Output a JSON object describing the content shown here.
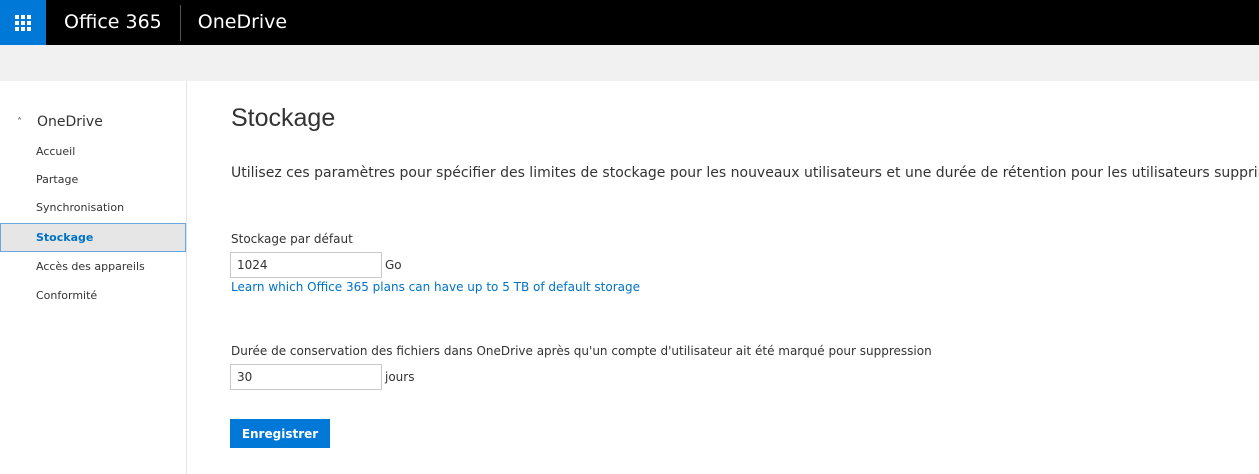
{
  "topbar": {
    "waffle_icon": "app-launcher-icon",
    "brand": "Office 365",
    "app_name": "OneDrive",
    "background": "#000000",
    "waffle_color": "#0078d7"
  },
  "nav": {
    "header": "OneDrive",
    "header_icon": "chevron-up-icon",
    "items": [
      {
        "label": "Accueil"
      },
      {
        "label": "Partage"
      },
      {
        "label": "Synchronisation"
      },
      {
        "label": "Stockage",
        "selected": true
      },
      {
        "label": "Accès des appareils"
      },
      {
        "label": "Conformité"
      }
    ]
  },
  "main": {
    "title": "Stockage",
    "description": "Utilisez ces paramètres pour spécifier des limites de stockage pour les nouveaux utilisateurs et une durée de rétention pour les utilisateurs supprimés.",
    "storage": {
      "label": "Stockage par défaut",
      "value": "1024",
      "unit": "Go",
      "link": "Learn which Office 365 plans can have up to 5 TB of default storage"
    },
    "retention": {
      "label": "Durée de conservation des fichiers dans OneDrive après qu'un compte d'utilisateur ait été marqué pour suppression",
      "value": "30",
      "unit": "jours"
    },
    "save_label": "Enregistrer",
    "accent": "#0078d7",
    "link_color": "#0072c6"
  }
}
